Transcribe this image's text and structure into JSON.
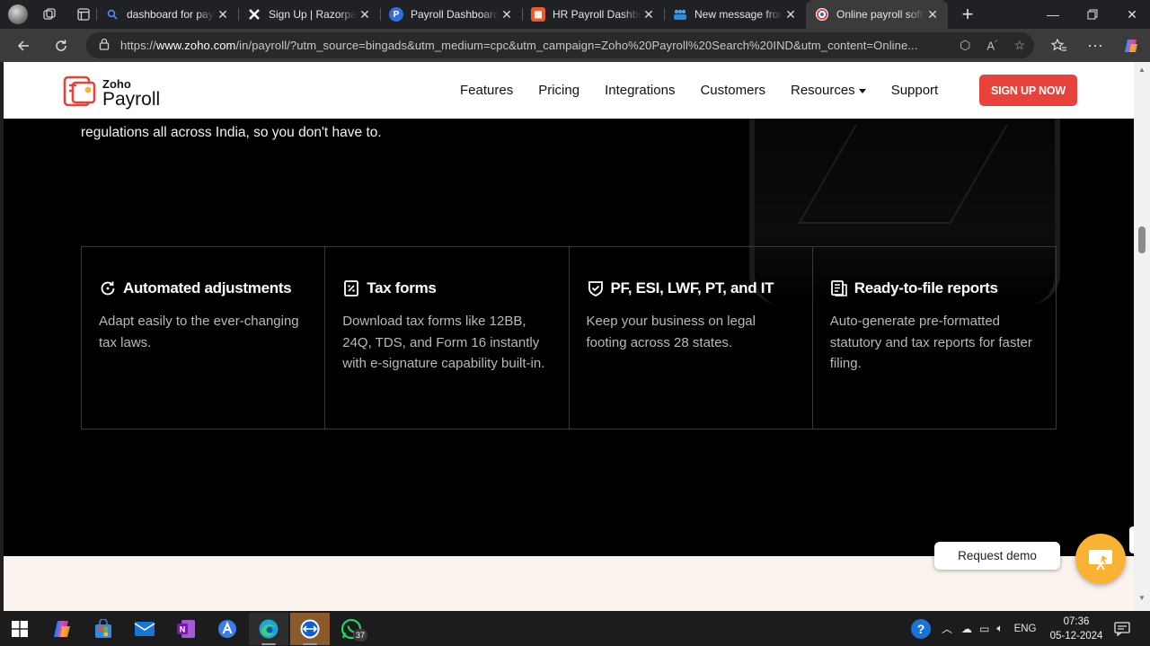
{
  "browser": {
    "tabs": [
      {
        "title": "dashboard for payroll",
        "favicon": "search-icon",
        "color": "#1a73e8"
      },
      {
        "title": "Sign Up | RazorpayX",
        "favicon": "razorpayx-icon",
        "color": "#ffffff"
      },
      {
        "title": "Payroll Dashboard G",
        "favicon": "payroll-p-icon",
        "color": "#2f6fe0"
      },
      {
        "title": "HR Payroll Dashboard",
        "favicon": "hr-dashboard-icon",
        "color": "#f05a28"
      },
      {
        "title": "New message from",
        "favicon": "teams-people-icon",
        "color": "#2f8ad8"
      },
      {
        "title": "Online payroll software",
        "favicon": "zoho-icon",
        "color": "#ffffff"
      }
    ],
    "new_tab": "+",
    "url_prefix": "https://",
    "url_host": "www.zoho.com",
    "url_rest": "/in/payroll/?utm_source=bingads&utm_medium=cpc&utm_campaign=Zoho%20Payroll%20Search%20IND&utm_content=Online..."
  },
  "site": {
    "logo_small": "Zoho",
    "logo_big": "Payroll",
    "nav": [
      "Features",
      "Pricing",
      "Integrations",
      "Customers",
      "Resources",
      "Support"
    ],
    "cta": "SIGN UP NOW",
    "intro": "regulations all across India, so you don't have to.",
    "features": [
      {
        "icon": "refresh-clock-icon",
        "title": "Automated adjustments",
        "text": "Adapt easily to the ever-changing tax laws."
      },
      {
        "icon": "percent-doc-icon",
        "title": "Tax forms",
        "text": "Download tax forms like 12BB, 24Q, TDS, and Form 16 instantly with e-signature capability built-in."
      },
      {
        "icon": "shield-check-icon",
        "title": "PF, ESI, LWF, PT, and IT",
        "text": "Keep your business on legal footing across 28 states."
      },
      {
        "icon": "report-doc-icon",
        "title": "Ready-to-file reports",
        "text": "Auto-generate pre-formatted statutory and tax reports for faster filing."
      }
    ],
    "demo_label": "Request demo",
    "accent": "#e8423b",
    "demo_color": "#f9b233"
  },
  "taskbar": {
    "whatsapp_badge": "37",
    "lang": "ENG",
    "time": "07:36",
    "date": "05-12-2024"
  }
}
